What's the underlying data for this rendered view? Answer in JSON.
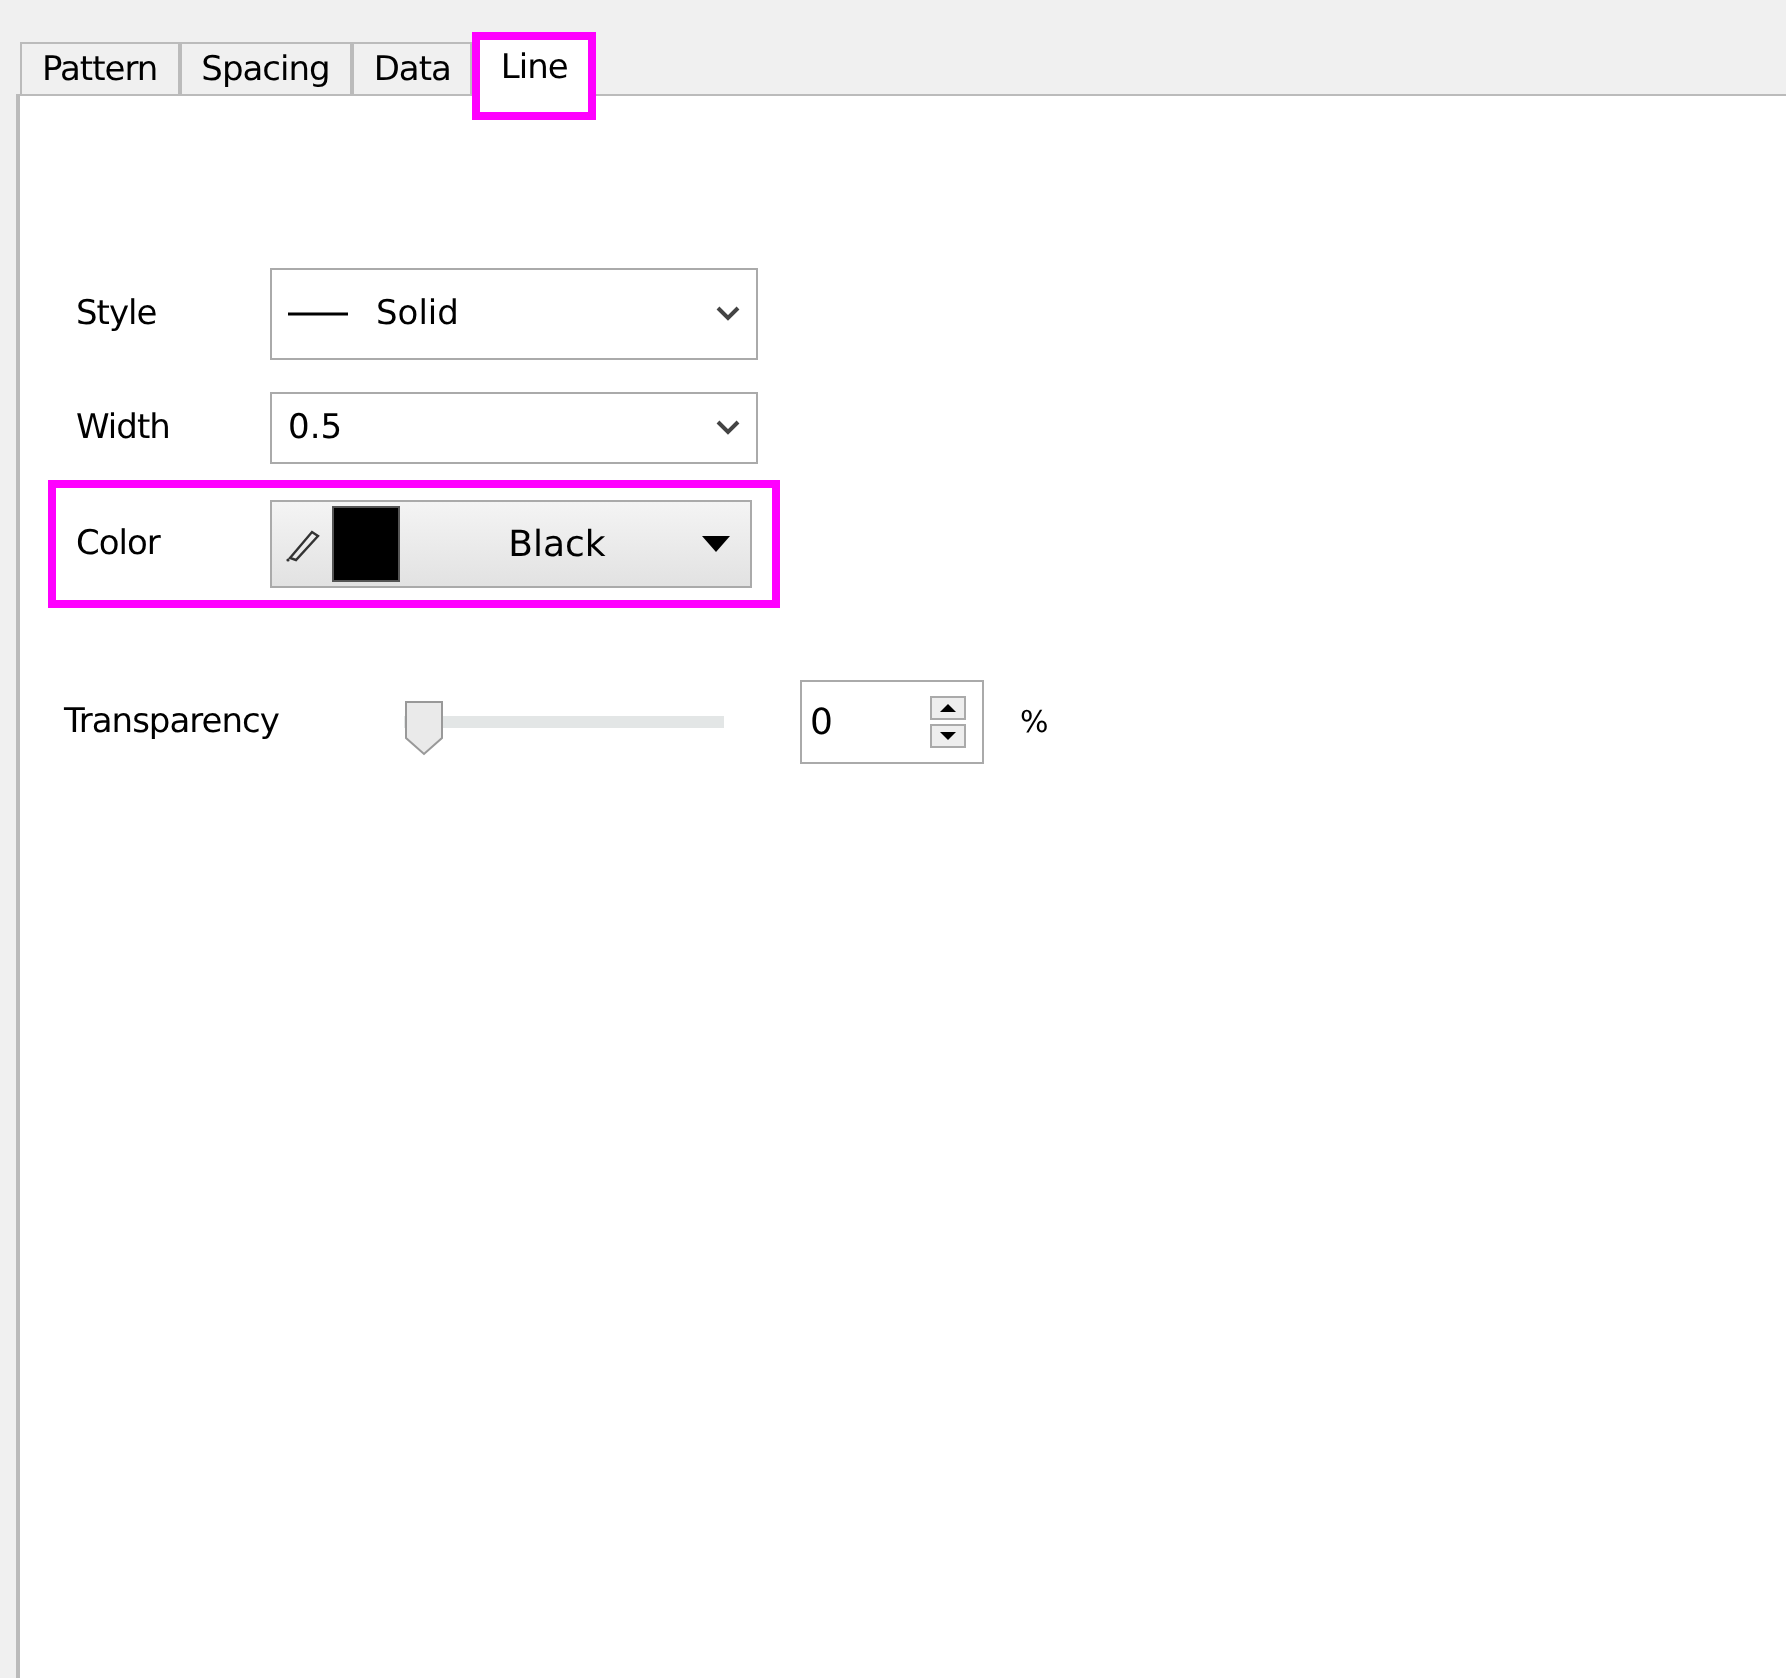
{
  "tabs": [
    {
      "label": "Pattern",
      "selected": false,
      "highlighted": false
    },
    {
      "label": "Spacing",
      "selected": false,
      "highlighted": false
    },
    {
      "label": "Data",
      "selected": false,
      "highlighted": false
    },
    {
      "label": "Line",
      "selected": true,
      "highlighted": true
    }
  ],
  "rows": [
    {
      "kind": "combo",
      "label": "Style",
      "value": "Solid",
      "line_sample": true,
      "highlighted": false
    },
    {
      "kind": "combo",
      "label": "Width",
      "value": "0.5",
      "line_sample": false,
      "highlighted": false
    },
    {
      "kind": "color",
      "label": "Color",
      "value": "Black",
      "color": "#000000",
      "highlighted": true
    }
  ],
  "transparency": {
    "label": "Transparency",
    "level": 0,
    "value": "0",
    "unit": "%"
  }
}
